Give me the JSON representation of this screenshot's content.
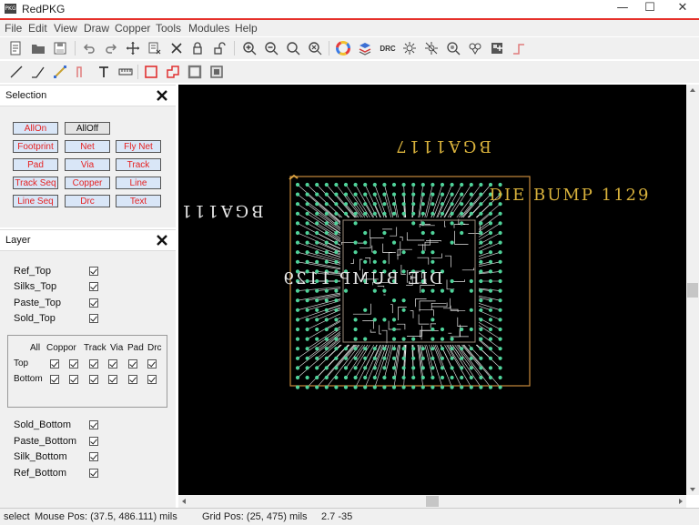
{
  "app": {
    "title": "RedPKG",
    "icon_text": "PKG",
    "controls": {
      "minimize": "—",
      "maximize": "☐",
      "close": "✕"
    }
  },
  "menu": [
    "File",
    "Edit",
    "View",
    "Draw",
    "Copper",
    "Tools",
    "Modules",
    "Help"
  ],
  "toolbar1": [
    "new-file",
    "open-folder",
    "save",
    "undo",
    "redo",
    "move",
    "list-edit",
    "delete",
    "lock",
    "unlock",
    "zoom-in",
    "zoom-out",
    "zoom-fit",
    "zoom-area",
    "color-wheel",
    "layers",
    "drc",
    "highlight",
    "no-highlight",
    "search-net",
    "net-explorer",
    "component-add",
    "step-line"
  ],
  "drc_label": "DRC",
  "toolbar2": [
    "draw-line",
    "draw-polyline",
    "draw-arc",
    "draw-step",
    "text-tool",
    "ruler",
    "rect-red",
    "poly-red",
    "rect-gray",
    "rect-dark"
  ],
  "selection": {
    "title": "Selection",
    "buttons": [
      {
        "label": "AllOn",
        "off": false
      },
      {
        "label": "AllOff",
        "off": true
      },
      {
        "label": "Footprint",
        "off": false
      },
      {
        "label": "Net",
        "off": false
      },
      {
        "label": "Fly Net",
        "off": false
      },
      {
        "label": "Pad",
        "off": false
      },
      {
        "label": "Via",
        "off": false
      },
      {
        "label": "Track",
        "off": false
      },
      {
        "label": "Track Seq",
        "off": false
      },
      {
        "label": "Copper",
        "off": false
      },
      {
        "label": "Line",
        "off": false
      },
      {
        "label": "Line Seq",
        "off": false
      },
      {
        "label": "Drc",
        "off": false
      },
      {
        "label": "Text",
        "off": false
      }
    ]
  },
  "layer": {
    "title": "Layer",
    "top_items": [
      "Ref_Top",
      "Silks_Top",
      "Paste_Top",
      "Sold_Top"
    ],
    "grid": {
      "headers": [
        "All",
        "Coppor",
        "Track",
        "Via",
        "Pad",
        "Drc"
      ],
      "rows": [
        "Top",
        "Bottom"
      ]
    },
    "bottom_items": [
      "Sold_Bottom",
      "Paste_Bottom",
      "Silk_Bottom",
      "Ref_Bottom"
    ]
  },
  "canvas": {
    "label_top": "BGA1117",
    "label_left": "BGA111",
    "label_right": "DIE BUMP 1129",
    "label_center": "DIE BUMP 1129"
  },
  "status": {
    "mode": "select",
    "mouse_pos": "Mouse Pos: (37.5, 486.111) mils",
    "grid_pos": "Grid Pos: (25, 475) mils",
    "extra": "2.7 -35"
  },
  "colors": {
    "accent": "#e6302a",
    "pad": "#4fd39a",
    "trace": "#e8e8e8",
    "outline": "#c88a3c",
    "label_gold": "#d9b23c"
  }
}
